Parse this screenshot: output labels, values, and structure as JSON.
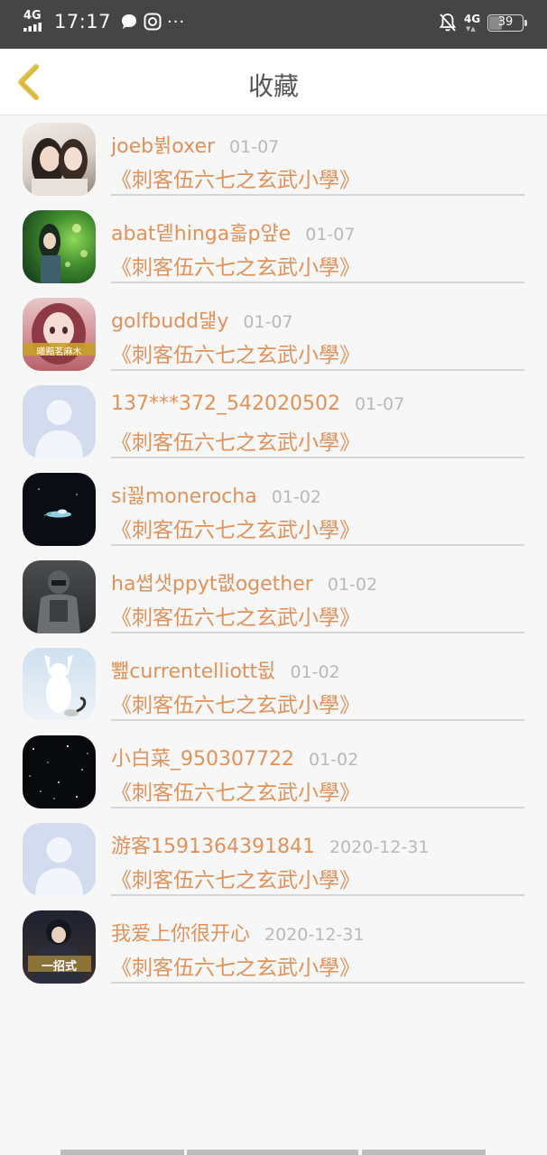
{
  "status": {
    "network": "4G",
    "time": "17:17",
    "more": "···",
    "network_right": "4G",
    "battery": "39"
  },
  "header": {
    "title": "收藏",
    "back_icon": "chevron-left-icon"
  },
  "colors": {
    "accent": "#e1925a",
    "back_icon": "#e2c14a",
    "status_bar": "#454545",
    "date": "#b9b9b9"
  },
  "items": [
    {
      "name": "joeb뷝oxer",
      "date": "01-07",
      "book": "《刺客伍六七之玄武小學》",
      "avatar": "photo-two-girls"
    },
    {
      "name": "abat돁hinga흛p얖e",
      "date": "01-07",
      "book": "《刺客伍六七之玄武小學》",
      "avatar": "anime-green"
    },
    {
      "name": "golfbudd댍y",
      "date": "01-07",
      "book": "《刺客伍六七之玄武小學》",
      "avatar": "anime-girl-pink",
      "avatar_caption": "曦黯茗麻木"
    },
    {
      "name": "137***372_542020502",
      "date": "01-07",
      "book": "《刺客伍六七之玄武小學》",
      "avatar": "default-user"
    },
    {
      "name": "si꾏monerocha",
      "date": "01-02",
      "book": "《刺客伍六七之玄武小學》",
      "avatar": "space-dark"
    },
    {
      "name": "ha쎱샛ppyt랪ogether",
      "date": "01-02",
      "book": "《刺客伍六七之玄武小學》",
      "avatar": "soldier"
    },
    {
      "name": "뾆currentelliott뒶",
      "date": "01-02",
      "book": "《刺客伍六七之玄武小學》",
      "avatar": "white-cat"
    },
    {
      "name": "小白菜_950307722",
      "date": "01-02",
      "book": "《刺客伍六七之玄武小學》",
      "avatar": "starry-night"
    },
    {
      "name": "游客1591364391841",
      "date": "2020-12-31",
      "book": "《刺客伍六七之玄武小學》",
      "avatar": "default-user"
    },
    {
      "name": "我爱上你很开心",
      "date": "2020-12-31",
      "book": "《刺客伍六七之玄武小學》",
      "avatar": "comic-cover",
      "avatar_caption": "一招式"
    }
  ]
}
